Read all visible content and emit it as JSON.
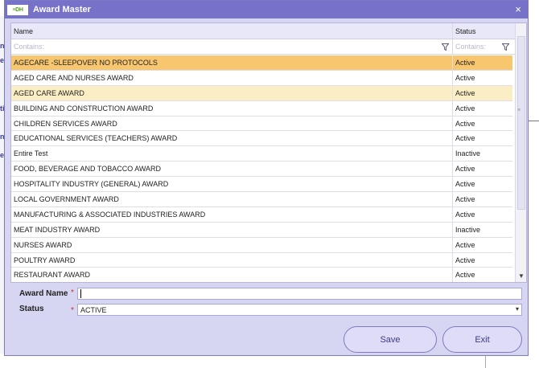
{
  "background": {
    "left_fragments": [
      "n",
      "e",
      "ti",
      "ni",
      "e"
    ]
  },
  "dialog": {
    "title": "Award Master",
    "logo_text": "≡DH",
    "close_label": "×"
  },
  "grid": {
    "columns": {
      "name": "Name",
      "status": "Status"
    },
    "filter_placeholder_name": "Contains:",
    "filter_placeholder_status": "Contains:",
    "rows": [
      {
        "name": "AGECARE -SLEEPOVER NO PROTOCOLS",
        "status": "Active"
      },
      {
        "name": "AGED CARE AND NURSES AWARD",
        "status": "Active"
      },
      {
        "name": "AGED CARE AWARD",
        "status": "Active"
      },
      {
        "name": "BUILDING AND CONSTRUCTION AWARD",
        "status": "Active"
      },
      {
        "name": "CHILDREN SERVICES AWARD",
        "status": "Active"
      },
      {
        "name": "EDUCATIONAL SERVICES (TEACHERS) AWARD",
        "status": "Active"
      },
      {
        "name": "Entire Test",
        "status": "Inactive"
      },
      {
        "name": "FOOD, BEVERAGE AND TOBACCO AWARD",
        "status": "Active"
      },
      {
        "name": "HOSPITALITY INDUSTRY (GENERAL) AWARD",
        "status": "Active"
      },
      {
        "name": "LOCAL GOVERNMENT AWARD",
        "status": "Active"
      },
      {
        "name": "MANUFACTURING & ASSOCIATED INDUSTRIES AWARD",
        "status": "Active"
      },
      {
        "name": "MEAT INDUSTRY AWARD",
        "status": "Inactive"
      },
      {
        "name": "NURSES AWARD",
        "status": "Active"
      },
      {
        "name": "POULTRY AWARD",
        "status": "Active"
      },
      {
        "name": "RESTAURANT AWARD",
        "status": "Active"
      }
    ],
    "selected_index": 0,
    "hover_index": 2
  },
  "form": {
    "award_name_label": "Award Name",
    "award_name_value": "",
    "status_label": "Status",
    "status_value": "ACTIVE",
    "required_mark": "*"
  },
  "buttons": {
    "save": "Save",
    "exit": "Exit"
  }
}
